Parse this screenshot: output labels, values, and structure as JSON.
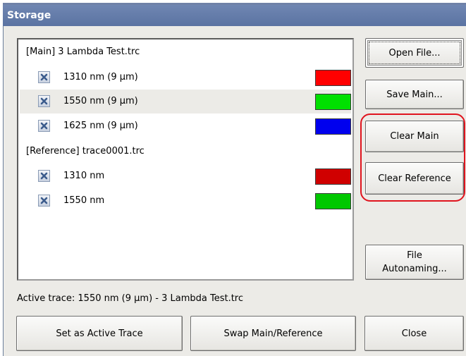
{
  "window": {
    "title": "Storage"
  },
  "main_group": {
    "title": "[Main] 3 Lambda Test.trc",
    "traces": [
      {
        "label": "1310 nm (9 µm)",
        "color": "#ff0000",
        "selected": false
      },
      {
        "label": "1550 nm (9 µm)",
        "color": "#00e000",
        "selected": true
      },
      {
        "label": "1625 nm (9 µm)",
        "color": "#0000ee",
        "selected": false
      }
    ]
  },
  "reference_group": {
    "title": "[Reference] trace0001.trc",
    "traces": [
      {
        "label": "1310 nm",
        "color": "#d00000"
      },
      {
        "label": "1550 nm",
        "color": "#00c800"
      }
    ]
  },
  "side_buttons": {
    "open_file": "Open File...",
    "save_main": "Save Main...",
    "clear_main": "Clear Main",
    "clear_reference": "Clear Reference",
    "file_autonaming_line1": "File",
    "file_autonaming_line2": "Autonaming..."
  },
  "status": {
    "active_trace": "Active trace: 1550 nm (9 µm) - 3 Lambda Test.trc"
  },
  "bottom_buttons": {
    "set_active": "Set as Active Trace",
    "swap": "Swap Main/Reference",
    "close": "Close"
  },
  "icons": {
    "trace_toggle": "remove-x-icon"
  },
  "colors": {
    "highlight": "#e0141e",
    "titlebar": "#5b73a2"
  }
}
